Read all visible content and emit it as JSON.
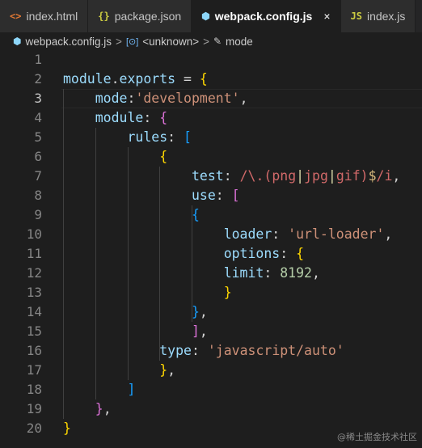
{
  "tabs": [
    {
      "label": "index.html",
      "icon": "<>",
      "icon_color": "#e37933",
      "active": false
    },
    {
      "label": "package.json",
      "icon": "{}",
      "icon_color": "#cbcb41",
      "active": false
    },
    {
      "label": "webpack.config.js",
      "icon": "⬢",
      "icon_color": "#8dd6f9",
      "active": true,
      "close": "×"
    },
    {
      "label": "index.js",
      "icon": "JS",
      "icon_color": "#cbcb41",
      "active": false
    }
  ],
  "breadcrumb": {
    "file": "webpack.config.js",
    "sep": ">",
    "item1_icon": "[⊙]",
    "item1": "<unknown>",
    "item2_icon": "🔧",
    "item2": "mode"
  },
  "editor": {
    "line_numbers": [
      "1",
      "2",
      "3",
      "4",
      "5",
      "6",
      "7",
      "8",
      "9",
      "10",
      "11",
      "12",
      "13",
      "14",
      "15",
      "16",
      "17",
      "18",
      "19",
      "20"
    ],
    "current_line": 3,
    "lines": [
      [],
      [
        [
          "obj",
          "module"
        ],
        [
          "plain",
          "."
        ],
        [
          "obj",
          "exports"
        ],
        [
          "plain",
          " = "
        ],
        [
          "b1",
          "{"
        ]
      ],
      [
        [
          "plain",
          "    "
        ],
        [
          "kw",
          "mode"
        ],
        [
          "plain",
          ":"
        ],
        [
          "str",
          "'development'"
        ],
        [
          "plain",
          ","
        ]
      ],
      [
        [
          "plain",
          "    "
        ],
        [
          "kw",
          "module"
        ],
        [
          "plain",
          ": "
        ],
        [
          "b2",
          "{"
        ]
      ],
      [
        [
          "plain",
          "        "
        ],
        [
          "kw",
          "rules"
        ],
        [
          "plain",
          ": "
        ],
        [
          "b3",
          "["
        ]
      ],
      [
        [
          "plain",
          "            "
        ],
        [
          "b1",
          "{"
        ]
      ],
      [
        [
          "plain",
          "                "
        ],
        [
          "kw",
          "test"
        ],
        [
          "plain",
          ": "
        ],
        [
          "rx",
          "/\\.("
        ],
        [
          "rx",
          "png"
        ],
        [
          "rxs",
          "|"
        ],
        [
          "rx",
          "jpg"
        ],
        [
          "rxs",
          "|"
        ],
        [
          "rx",
          "gif"
        ],
        [
          "rx",
          ")"
        ],
        [
          "rxe",
          "$"
        ],
        [
          "rx",
          "/i"
        ],
        [
          "plain",
          ","
        ]
      ],
      [
        [
          "plain",
          "                "
        ],
        [
          "kw",
          "use"
        ],
        [
          "plain",
          ": "
        ],
        [
          "b2",
          "["
        ]
      ],
      [
        [
          "plain",
          "                "
        ],
        [
          "b3",
          "{"
        ]
      ],
      [
        [
          "plain",
          "                    "
        ],
        [
          "kw",
          "loader"
        ],
        [
          "plain",
          ": "
        ],
        [
          "str",
          "'url-loader'"
        ],
        [
          "plain",
          ","
        ]
      ],
      [
        [
          "plain",
          "                    "
        ],
        [
          "kw",
          "options"
        ],
        [
          "plain",
          ": "
        ],
        [
          "b1",
          "{"
        ]
      ],
      [
        [
          "plain",
          "                    "
        ],
        [
          "kw",
          "limit"
        ],
        [
          "plain",
          ": "
        ],
        [
          "num",
          "8192"
        ],
        [
          "plain",
          ","
        ]
      ],
      [
        [
          "plain",
          "                    "
        ],
        [
          "b1",
          "}"
        ]
      ],
      [
        [
          "plain",
          "                "
        ],
        [
          "b3",
          "}"
        ],
        [
          "plain",
          ","
        ]
      ],
      [
        [
          "plain",
          "                "
        ],
        [
          "b2",
          "]"
        ],
        [
          "plain",
          ","
        ]
      ],
      [
        [
          "plain",
          "            "
        ],
        [
          "kw",
          "type"
        ],
        [
          "plain",
          ": "
        ],
        [
          "str",
          "'javascript/auto'"
        ]
      ],
      [
        [
          "plain",
          "            "
        ],
        [
          "b1",
          "}"
        ],
        [
          "plain",
          ","
        ]
      ],
      [
        [
          "plain",
          "        "
        ],
        [
          "b3",
          "]"
        ]
      ],
      [
        [
          "plain",
          "    "
        ],
        [
          "b2",
          "}"
        ],
        [
          "plain",
          ","
        ]
      ],
      [
        [
          "b1",
          "}"
        ]
      ]
    ]
  },
  "watermark": "@稀土掘金技术社区"
}
